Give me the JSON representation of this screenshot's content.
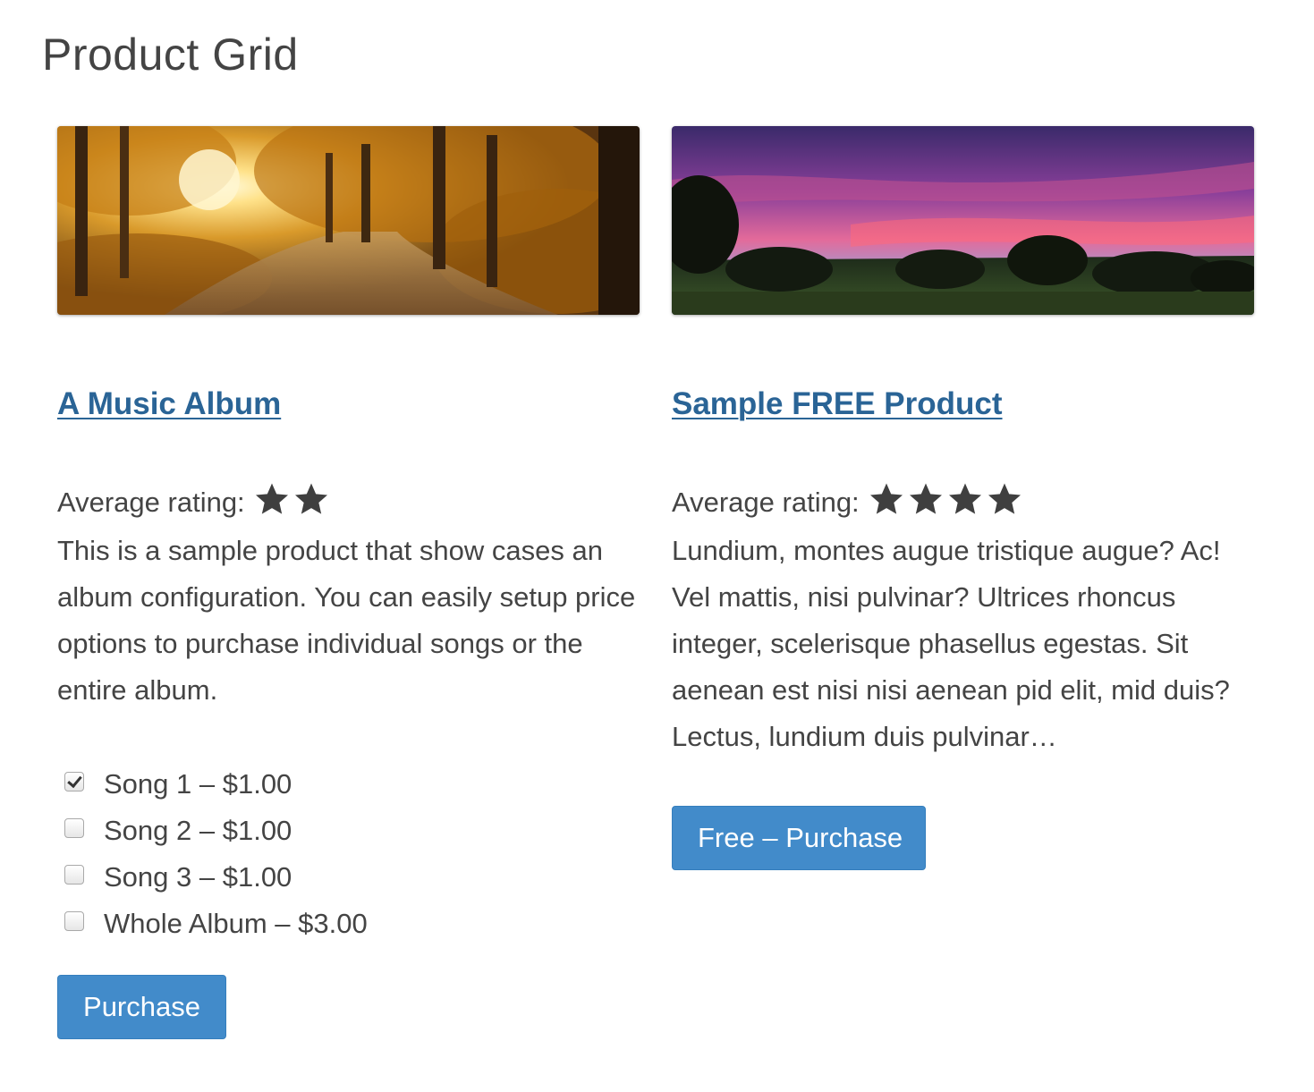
{
  "page": {
    "title": "Product Grid"
  },
  "colors": {
    "link": "#2a6496",
    "button": "#428bca",
    "text": "#444444",
    "star": "#3f3f3f"
  },
  "products": [
    {
      "title": "A Music Album",
      "image_desc": "autumn forest path",
      "rating_label": "Average rating:",
      "rating": 2,
      "description": "This is a sample product that show cases an album configuration. You can easily setup price options to purchase individual songs or the entire album.",
      "options": [
        {
          "label": "Song 1 – $1.00",
          "checked": true
        },
        {
          "label": "Song 2 – $1.00",
          "checked": false
        },
        {
          "label": "Song 3 – $1.00",
          "checked": false
        },
        {
          "label": "Whole Album – $3.00",
          "checked": false
        }
      ],
      "button_label": "Purchase"
    },
    {
      "title": "Sample FREE Product",
      "image_desc": "purple sunset over treeline",
      "rating_label": "Average rating:",
      "rating": 4,
      "description": "Lundium, montes augue tristique augue? Ac! Vel mattis, nisi pulvinar? Ultrices rhoncus integer, scelerisque phasellus egestas. Sit aenean est nisi nisi aenean pid elit, mid duis? Lectus, lundium duis pulvinar…",
      "button_label": "Free – Purchase"
    }
  ]
}
